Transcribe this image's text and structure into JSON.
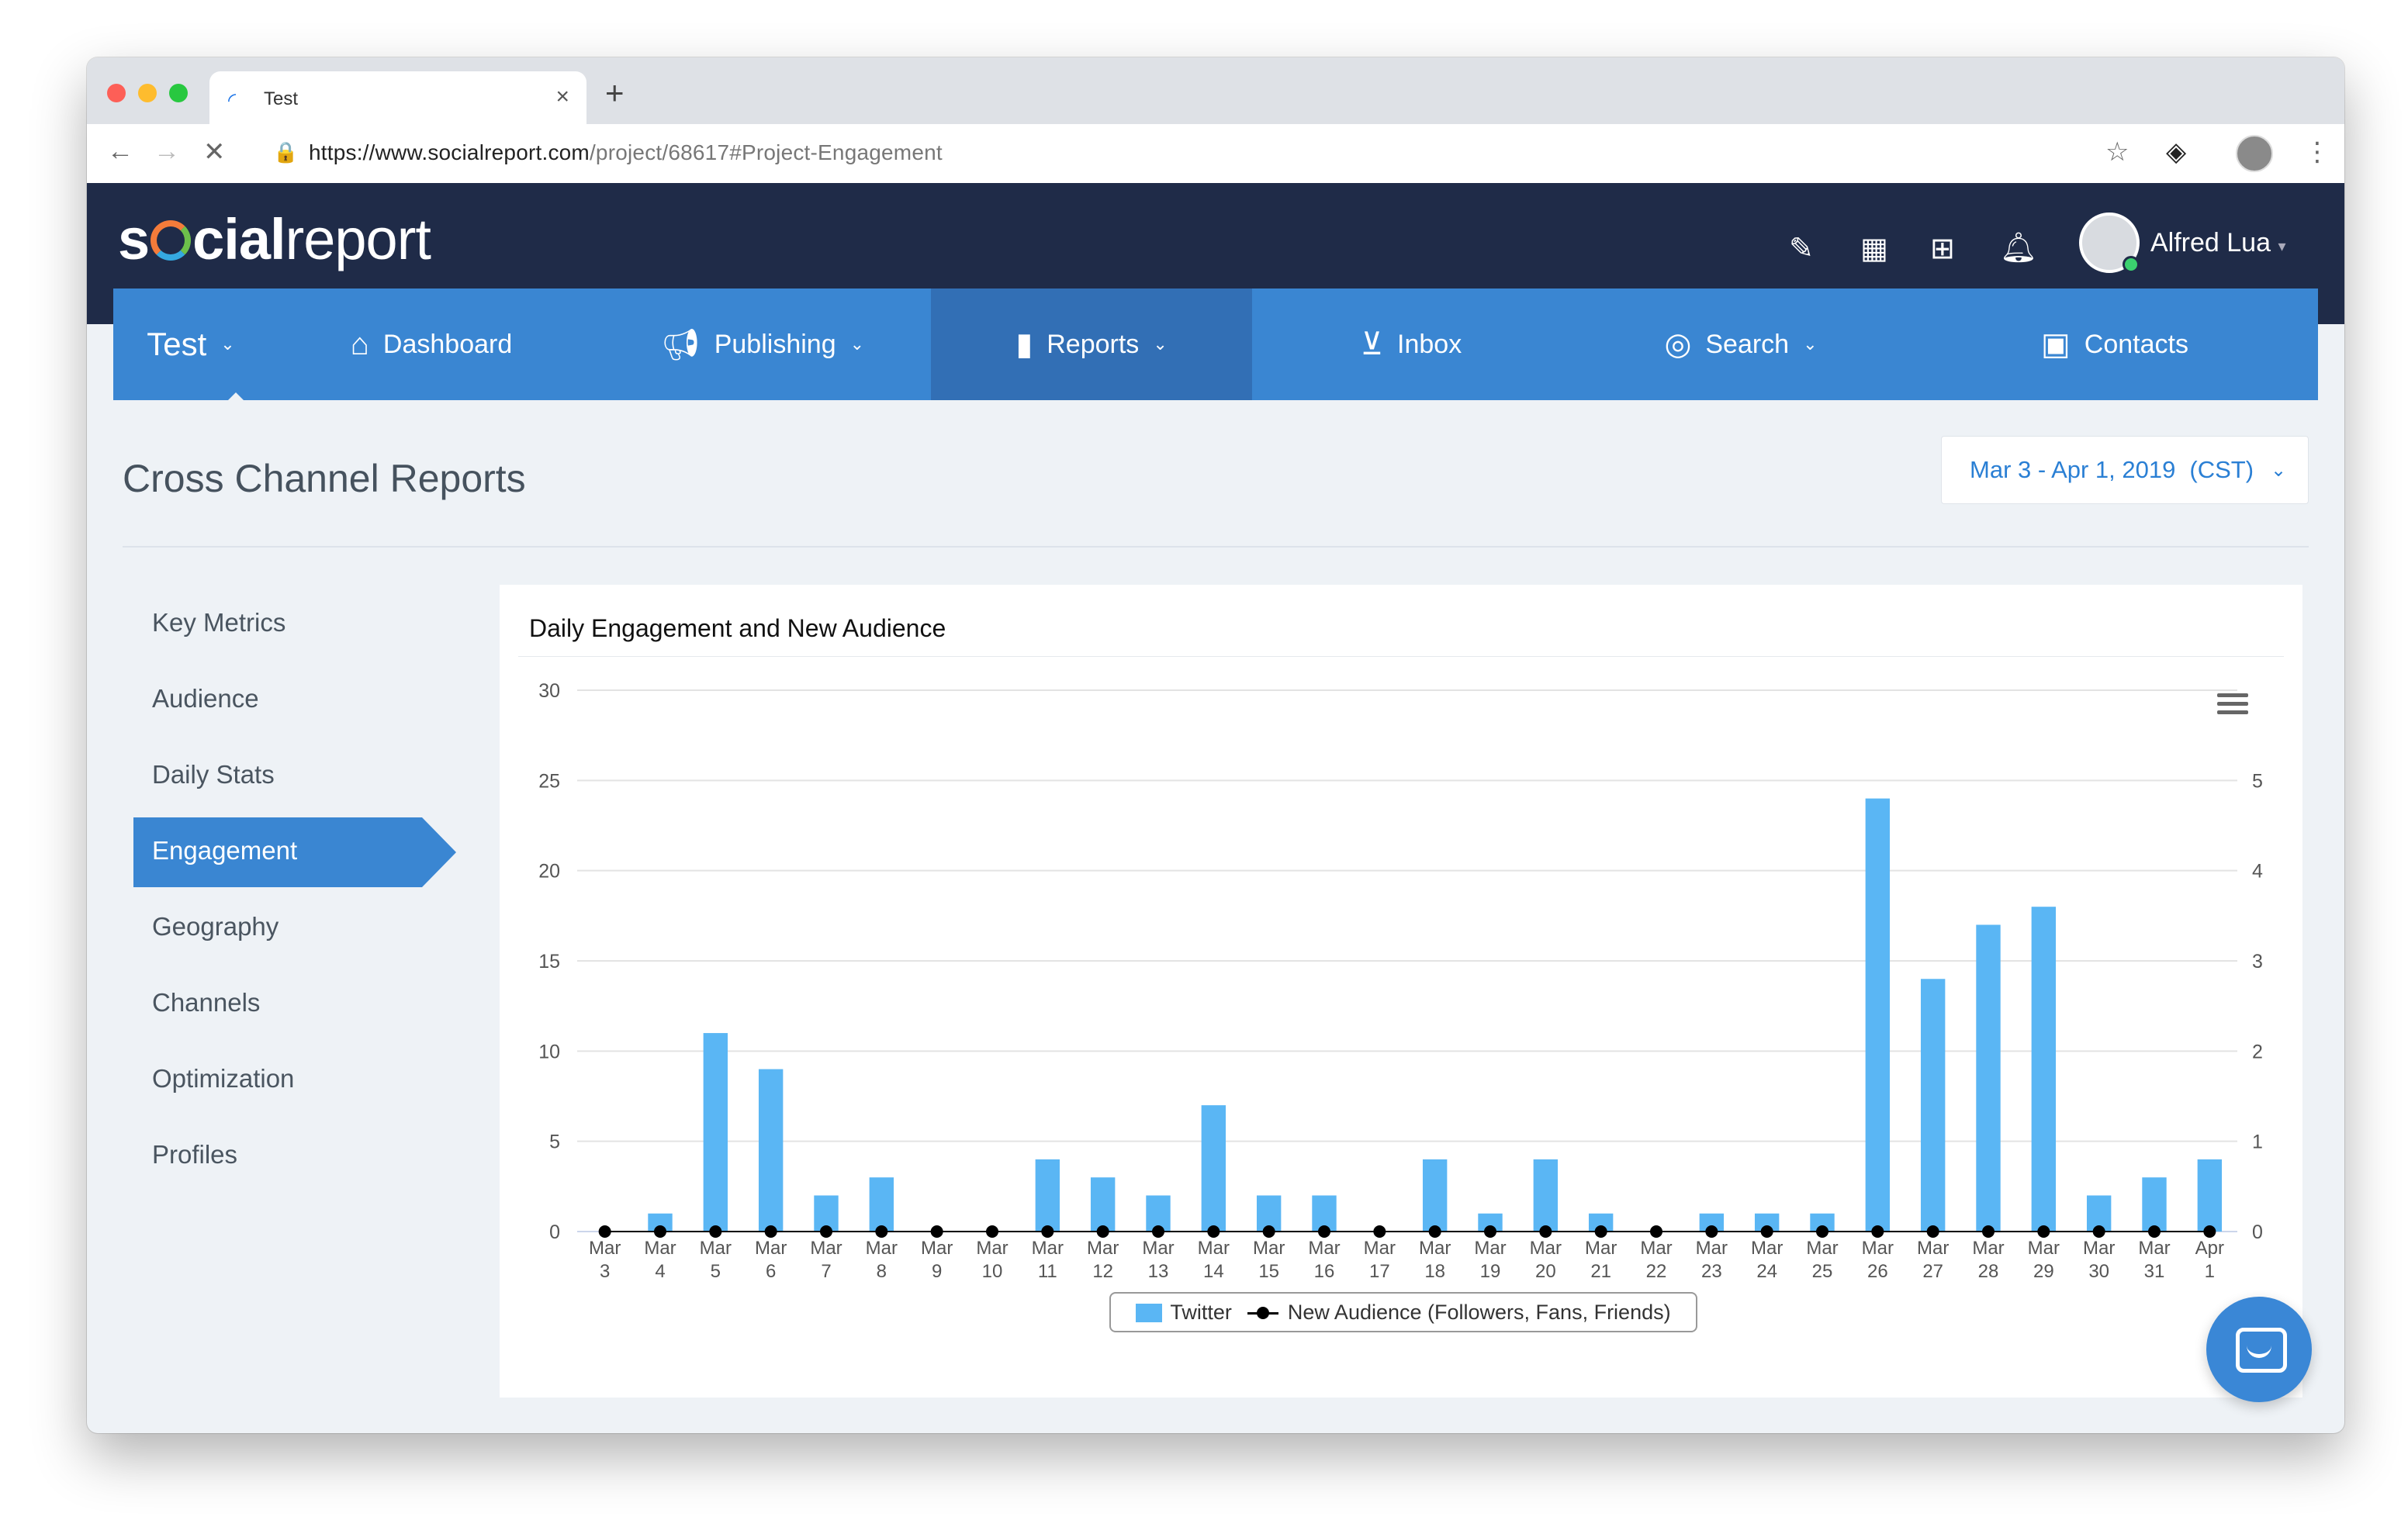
{
  "browser": {
    "tab_title": "Test",
    "new_tab": "+",
    "url_domain": "https://www.socialreport.com",
    "url_path": "/project/68617#Project-Engagement"
  },
  "app": {
    "logo_part1": "s",
    "logo_part2": "cial",
    "logo_part3": "report",
    "user_name": "Alfred Lua"
  },
  "nav": {
    "project": "Test",
    "items": [
      {
        "label": "Dashboard",
        "icon": "home-icon"
      },
      {
        "label": "Publishing",
        "icon": "megaphone-icon"
      },
      {
        "label": "Reports",
        "icon": "bar-chart-icon"
      },
      {
        "label": "Inbox",
        "icon": "inbox-icon"
      },
      {
        "label": "Search",
        "icon": "target-icon"
      },
      {
        "label": "Contacts",
        "icon": "contacts-icon"
      }
    ]
  },
  "page": {
    "title": "Cross Channel Reports",
    "date_range": "Mar 3 - Apr 1, 2019",
    "timezone": "(CST)"
  },
  "sidebar": {
    "items": [
      {
        "label": "Key Metrics"
      },
      {
        "label": "Audience"
      },
      {
        "label": "Daily Stats"
      },
      {
        "label": "Engagement"
      },
      {
        "label": "Geography"
      },
      {
        "label": "Channels"
      },
      {
        "label": "Optimization"
      },
      {
        "label": "Profiles"
      }
    ]
  },
  "colors": {
    "nav_blue": "#3a86d2",
    "header_navy": "#1f2b48",
    "bar_blue": "#5ab6f4"
  },
  "chart_data": {
    "type": "bar",
    "title": "Daily Engagement and New Audience",
    "categories": [
      [
        "Mar",
        "3"
      ],
      [
        "Mar",
        "4"
      ],
      [
        "Mar",
        "5"
      ],
      [
        "Mar",
        "6"
      ],
      [
        "Mar",
        "7"
      ],
      [
        "Mar",
        "8"
      ],
      [
        "Mar",
        "9"
      ],
      [
        "Mar",
        "10"
      ],
      [
        "Mar",
        "11"
      ],
      [
        "Mar",
        "12"
      ],
      [
        "Mar",
        "13"
      ],
      [
        "Mar",
        "14"
      ],
      [
        "Mar",
        "15"
      ],
      [
        "Mar",
        "16"
      ],
      [
        "Mar",
        "17"
      ],
      [
        "Mar",
        "18"
      ],
      [
        "Mar",
        "19"
      ],
      [
        "Mar",
        "20"
      ],
      [
        "Mar",
        "21"
      ],
      [
        "Mar",
        "22"
      ],
      [
        "Mar",
        "23"
      ],
      [
        "Mar",
        "24"
      ],
      [
        "Mar",
        "25"
      ],
      [
        "Mar",
        "26"
      ],
      [
        "Mar",
        "27"
      ],
      [
        "Mar",
        "28"
      ],
      [
        "Mar",
        "29"
      ],
      [
        "Mar",
        "30"
      ],
      [
        "Mar",
        "31"
      ],
      [
        "Apr",
        "1"
      ]
    ],
    "series": [
      {
        "name": "Twitter",
        "type": "bar",
        "axis": "left",
        "values": [
          0,
          1,
          11,
          9,
          2,
          3,
          0,
          0,
          4,
          3,
          2,
          7,
          2,
          2,
          0,
          4,
          1,
          4,
          1,
          0,
          1,
          1,
          1,
          24,
          14,
          17,
          18,
          2,
          3,
          4
        ]
      },
      {
        "name": "New Audience (Followers, Fans, Friends)",
        "type": "line",
        "axis": "right",
        "values": [
          0,
          0,
          0,
          0,
          0,
          0,
          0,
          0,
          0,
          0,
          0,
          0,
          0,
          0,
          0,
          0,
          0,
          0,
          0,
          0,
          0,
          0,
          0,
          0,
          0,
          0,
          0,
          0,
          0,
          0
        ]
      }
    ],
    "y_left_ticks": [
      "0",
      "5",
      "10",
      "15",
      "20",
      "25",
      "30"
    ],
    "y_left_range": [
      0,
      30
    ],
    "y_right_ticks": [
      "0",
      "1",
      "2",
      "3",
      "4",
      "5"
    ],
    "y_right_range": [
      0,
      6
    ],
    "grid": true,
    "legend_position": "bottom-center"
  }
}
